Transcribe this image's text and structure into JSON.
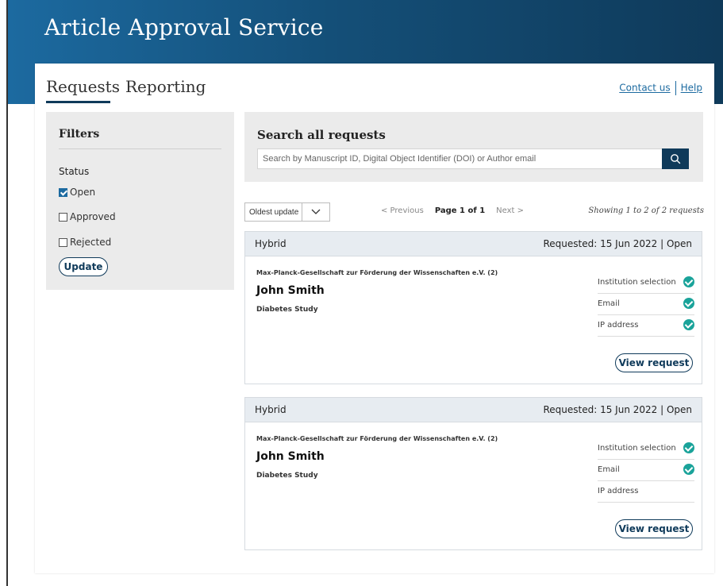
{
  "app": {
    "title": "Article Approval Service"
  },
  "nav": {
    "tabs": [
      {
        "label": "Requests"
      },
      {
        "label": "Reporting"
      }
    ],
    "contact_label": "Contact us",
    "help_label": "Help"
  },
  "filters": {
    "title": "Filters",
    "status_label": "Status",
    "options": [
      {
        "label": "Open",
        "checked": true
      },
      {
        "label": "Approved",
        "checked": false
      },
      {
        "label": "Rejected",
        "checked": false
      }
    ],
    "update_label": "Update"
  },
  "search": {
    "title": "Search all requests",
    "placeholder": "Search by Manuscript ID, Digital Object Identifier (DOI) or Author email",
    "icon": "search-icon"
  },
  "toolbar": {
    "sort_value": "Oldest update",
    "prev_label": "< Previous",
    "page_label": "Page 1 of 1",
    "next_label": "Next >",
    "showing_label": "Showing 1 to 2 of 2 requests"
  },
  "colors": {
    "brand": "#0f3a5a",
    "accent": "#1c6aa0",
    "success": "#1aa39a",
    "panel": "#ebebeb",
    "card_head": "#e7ecf1"
  },
  "requests": [
    {
      "type": "Hybrid",
      "requested": "Requested: 15 Jun 2022 | Open",
      "institution": "Max-Planck-Gesellschaft zur Förderung der Wissenschaften e.V. (2)",
      "name": "John Smith",
      "study": "Diabetes Study",
      "checks": [
        {
          "label": "Institution selection",
          "ok": true
        },
        {
          "label": "Email",
          "ok": true
        },
        {
          "label": "IP address",
          "ok": true
        }
      ],
      "view_label": "View request"
    },
    {
      "type": "Hybrid",
      "requested": "Requested: 15 Jun 2022 | Open",
      "institution": "Max-Planck-Gesellschaft zur Förderung der Wissenschaften e.V. (2)",
      "name": "John Smith",
      "study": "Diabetes Study",
      "checks": [
        {
          "label": "Institution selection",
          "ok": true
        },
        {
          "label": "Email",
          "ok": true
        },
        {
          "label": "IP address",
          "ok": false
        }
      ],
      "view_label": "View request"
    }
  ]
}
